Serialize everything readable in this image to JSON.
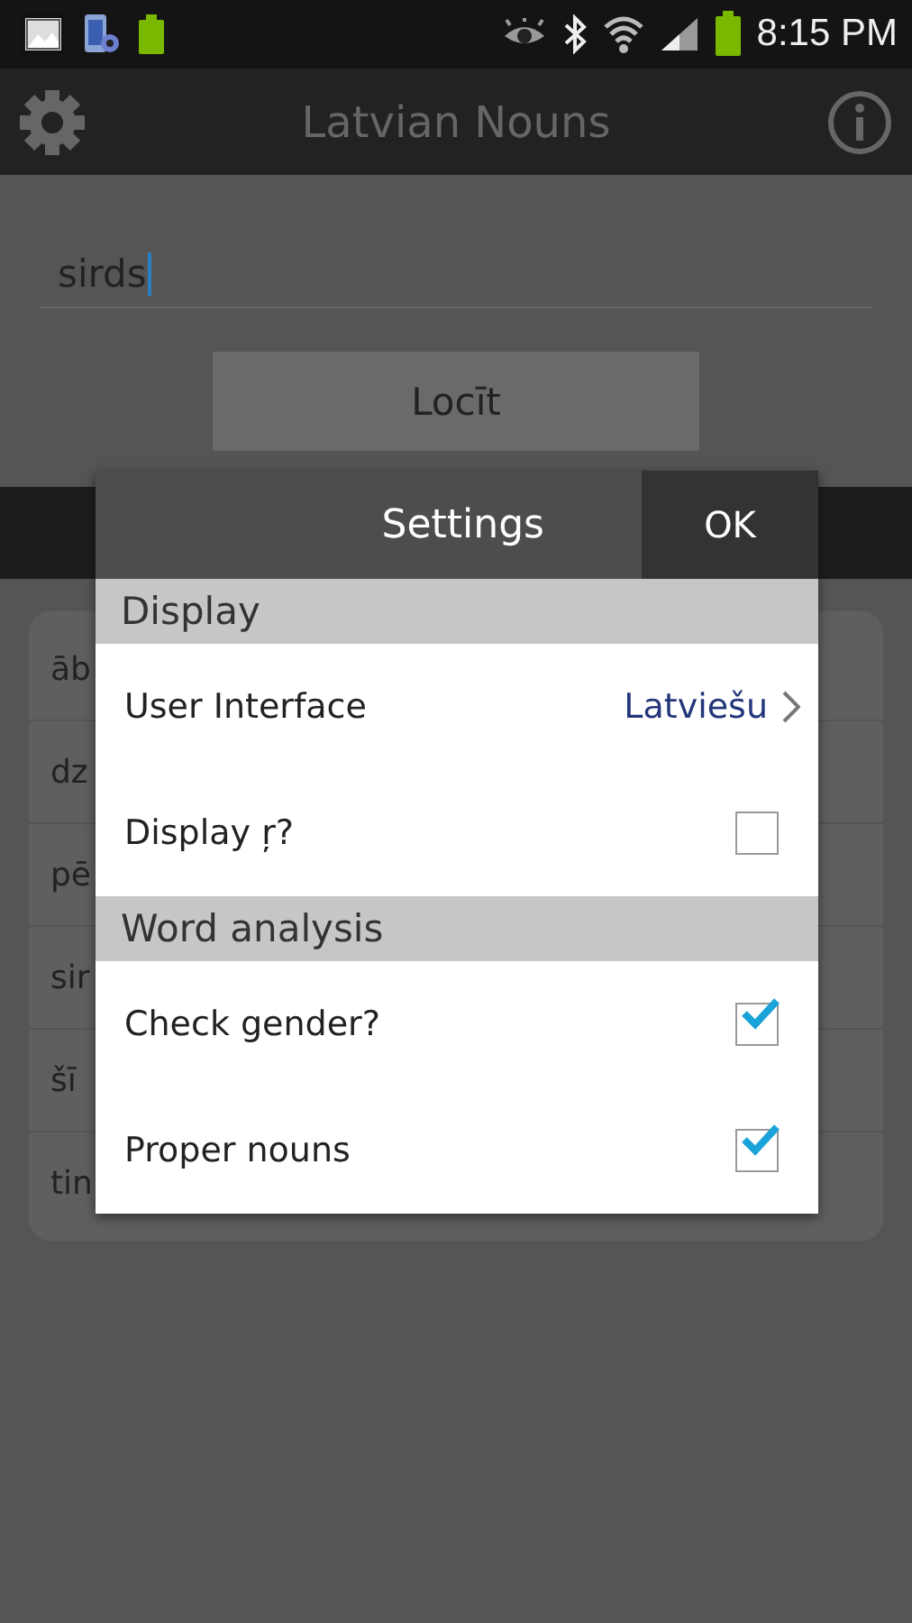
{
  "status_bar": {
    "time": "8:15 PM"
  },
  "app_bar": {
    "title": "Latvian Nouns"
  },
  "word_field": {
    "value": "sirds"
  },
  "decline_button": {
    "label": "Locīt"
  },
  "results": [
    {
      "text": "āb"
    },
    {
      "text": "dz"
    },
    {
      "text": "pē"
    },
    {
      "text": "sir"
    },
    {
      "text": "šī"
    },
    {
      "text": "tin"
    }
  ],
  "dialog": {
    "title": "Settings",
    "ok_button": "OK",
    "sections": [
      {
        "header": "Display",
        "items": [
          {
            "kind": "choice",
            "label": "User Interface",
            "value": "Latviešu"
          },
          {
            "kind": "checkbox",
            "label": "Display ŗ?",
            "checked": false
          }
        ]
      },
      {
        "header": "Word analysis",
        "items": [
          {
            "kind": "checkbox",
            "label": "Check gender?",
            "checked": true
          },
          {
            "kind": "checkbox",
            "label": "Proper nouns",
            "checked": true
          }
        ]
      }
    ]
  }
}
